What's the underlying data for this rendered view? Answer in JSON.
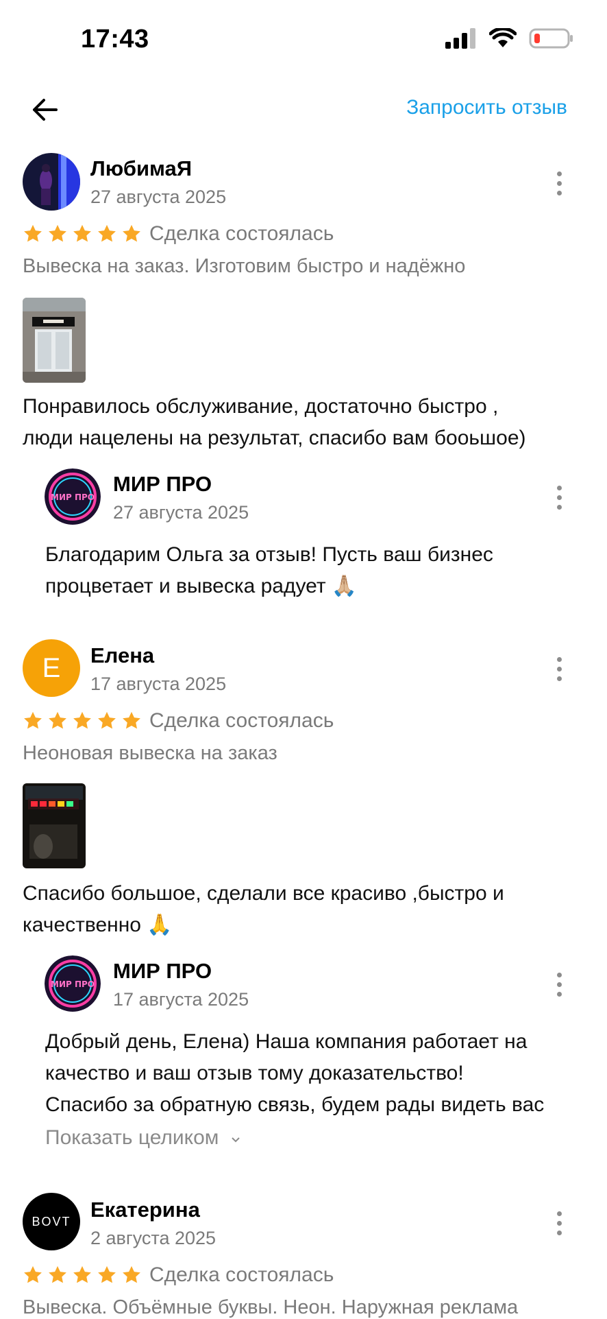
{
  "status_bar": {
    "time": "17:43"
  },
  "nav": {
    "request_label": "Запросить отзыв"
  },
  "colors": {
    "accent": "#1aa0e8",
    "star": "#f9a825",
    "muted": "#7a7a7a",
    "avatar_orange": "#f6a207"
  },
  "reviews": [
    {
      "author": "ЛюбимаЯ",
      "date": "27 августа 2025",
      "rating": 5,
      "deal": "Сделка состоялась",
      "subject": "Вывеска на заказ. Изготовим быстро и надёжно",
      "text_line1": "Понравилось обслуживание,  достаточно быстро ,",
      "text_line2": "люди нацелены на результат, спасибо вам бооьшое)",
      "reply": {
        "author": "МИР ПРО",
        "date": "27 августа 2025",
        "line1": "Благодарим Ольга за отзыв! Пусть ваш бизнес",
        "line2": "процветает и вывеска радует 🙏🏼"
      }
    },
    {
      "author": "Елена",
      "avatar_letter": "Е",
      "date": "17 августа 2025",
      "rating": 5,
      "deal": "Сделка состоялась",
      "subject": "Неоновая вывеска на заказ",
      "text_line1": "Спасибо большое, сделали все красиво ,быстро и",
      "text_line2": "качественно 🙏",
      "reply": {
        "author": "МИР ПРО",
        "date": "17 августа 2025",
        "line1": "Добрый день, Елена) Наша компания работает на",
        "line2": "качество и ваш отзыв тому доказательство!",
        "line3": "Спасибо за обратную связь, будем рады видеть вас",
        "show_more": "Показать целиком"
      }
    },
    {
      "author": "Екатерина",
      "avatar_text": "BOVT",
      "date": "2 августа 2025",
      "rating": 5,
      "deal": "Сделка состоялась",
      "subject": "Вывеска. Объёмные буквы. Неон. Наружная реклама"
    }
  ],
  "logo_text": "МИР ПРО"
}
